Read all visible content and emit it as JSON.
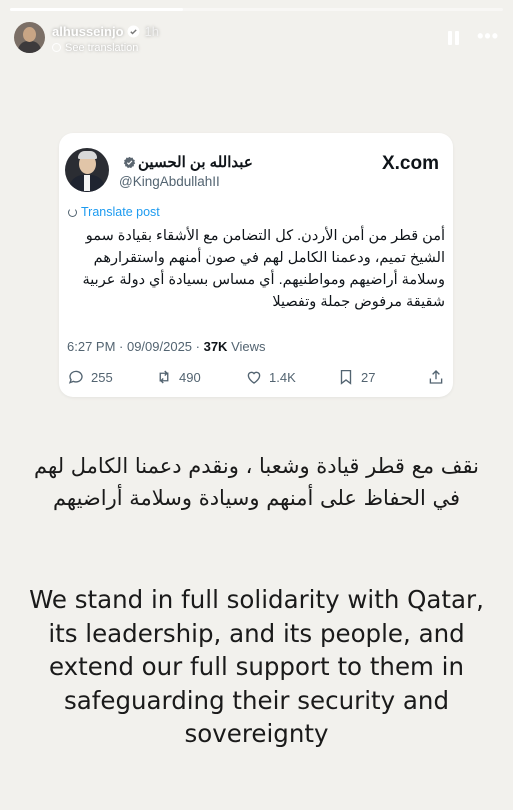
{
  "story": {
    "progress": 0.35,
    "username": "alhusseinjo",
    "time": "1h",
    "see_translation": "See translation",
    "pause_icon": "pause-icon",
    "more_icon": "more-horizontal-icon"
  },
  "tweet": {
    "name": "عبدالله بن الحسين",
    "handle": "@KingAbdullahII",
    "platform": "X.com",
    "translate_label": "Translate post",
    "text": "أمن قطر من أمن الأردن. كل التضامن مع الأشقاء بقيادة سمو الشيخ تميم، ودعمنا الكامل لهم في صون أمنهم واستقرارهم وسلامة أراضيهم ومواطنيهم. أي مساس بسيادة أي دولة عربية شقيقة مرفوض جملة وتفصيلا",
    "timestamp": "6:27 PM · 09/09/2025 · ",
    "views_count": "37K",
    "views_label": " Views",
    "replies": "255",
    "reposts": "490",
    "likes": "1.4K",
    "bookmarks": "27",
    "verified_color": "#1d9bf0"
  },
  "message": {
    "arabic": "نقف مع قطر قيادة وشعبا ، ونقدم دعمنا الكامل لهم في الحفاظ على أمنهم وسيادة وسلامة أراضيهم",
    "english": "We stand in full solidarity with Qatar, its leadership, and its people, and extend our full support to them in safeguarding their security and sovereignty"
  }
}
